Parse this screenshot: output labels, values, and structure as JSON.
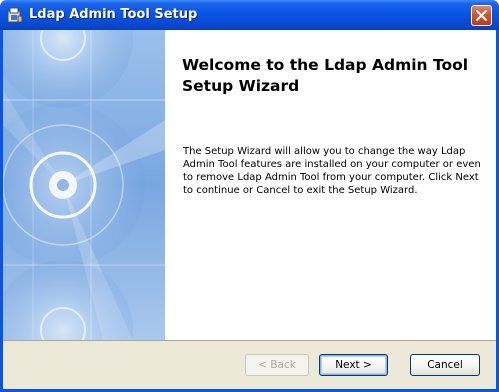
{
  "window": {
    "title": "Ldap Admin Tool Setup"
  },
  "welcome": {
    "heading": "Welcome to the Ldap Admin Tool Setup Wizard",
    "description": "The Setup Wizard will allow you to change the way Ldap Admin Tool features are installed on your computer or even to remove Ldap Admin Tool from your computer.  Click Next to continue or Cancel to exit the Setup Wizard."
  },
  "buttons": {
    "back_label": "< Back",
    "next_label": "Next >",
    "cancel_label": "Cancel"
  },
  "icons": {
    "app": "installer-icon",
    "close": "close-icon"
  },
  "colors": {
    "titlebar": "#0a55e6",
    "close_button": "#d6512c",
    "footer": "#ece9d8",
    "banner": "#8fb6e6"
  }
}
